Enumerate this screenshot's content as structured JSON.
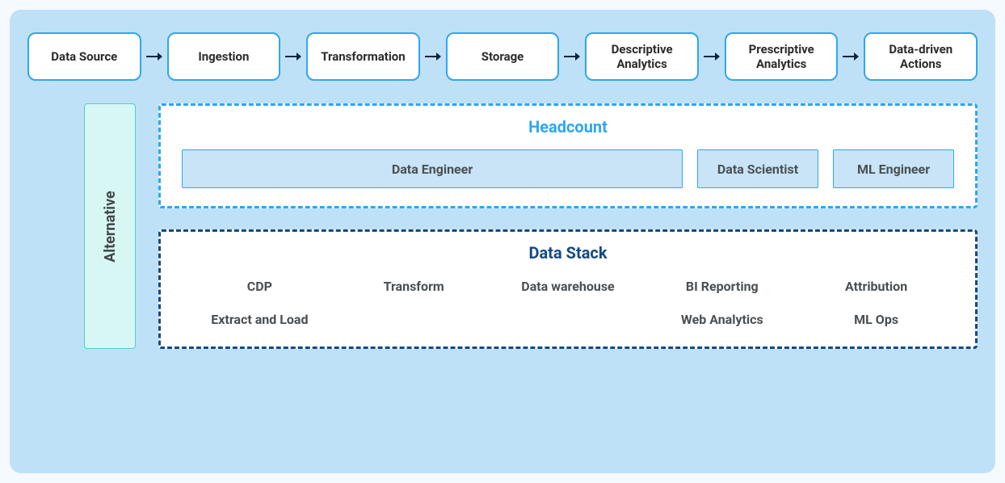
{
  "pipeline": {
    "stages": [
      "Data Source",
      "Ingestion",
      "Transformation",
      "Storage",
      "Descriptive Analytics",
      "Prescriptive Analytics",
      "Data-driven Actions"
    ]
  },
  "alternative": {
    "label": "Alternative"
  },
  "headcount": {
    "title": "Headcount",
    "roles": {
      "data_engineer": "Data Engineer",
      "data_scientist": "Data Scientist",
      "ml_engineer": "ML Engineer"
    }
  },
  "datastack": {
    "title": "Data Stack",
    "row1": [
      "CDP",
      "Transform",
      "Data warehouse",
      "BI Reporting",
      "Attribution"
    ],
    "row2": [
      "Extract and Load",
      "",
      "",
      "Web Analytics",
      "ML Ops"
    ]
  }
}
